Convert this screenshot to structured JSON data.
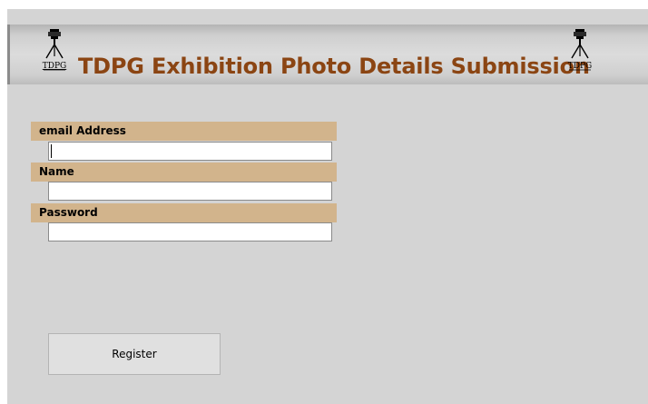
{
  "header": {
    "title": "TDPG Exhibition Photo Details Submission",
    "logo_text": "TDPG",
    "title_color": "#8b4513"
  },
  "form": {
    "email": {
      "label": "email Address",
      "value": "",
      "placeholder": ""
    },
    "name": {
      "label": "Name",
      "value": "",
      "placeholder": ""
    },
    "password": {
      "label": "Password",
      "value": "",
      "placeholder": ""
    },
    "label_color": "#d2b48c"
  },
  "actions": {
    "register_label": "Register"
  },
  "icons": {
    "logo": "tripod-camera-icon"
  }
}
